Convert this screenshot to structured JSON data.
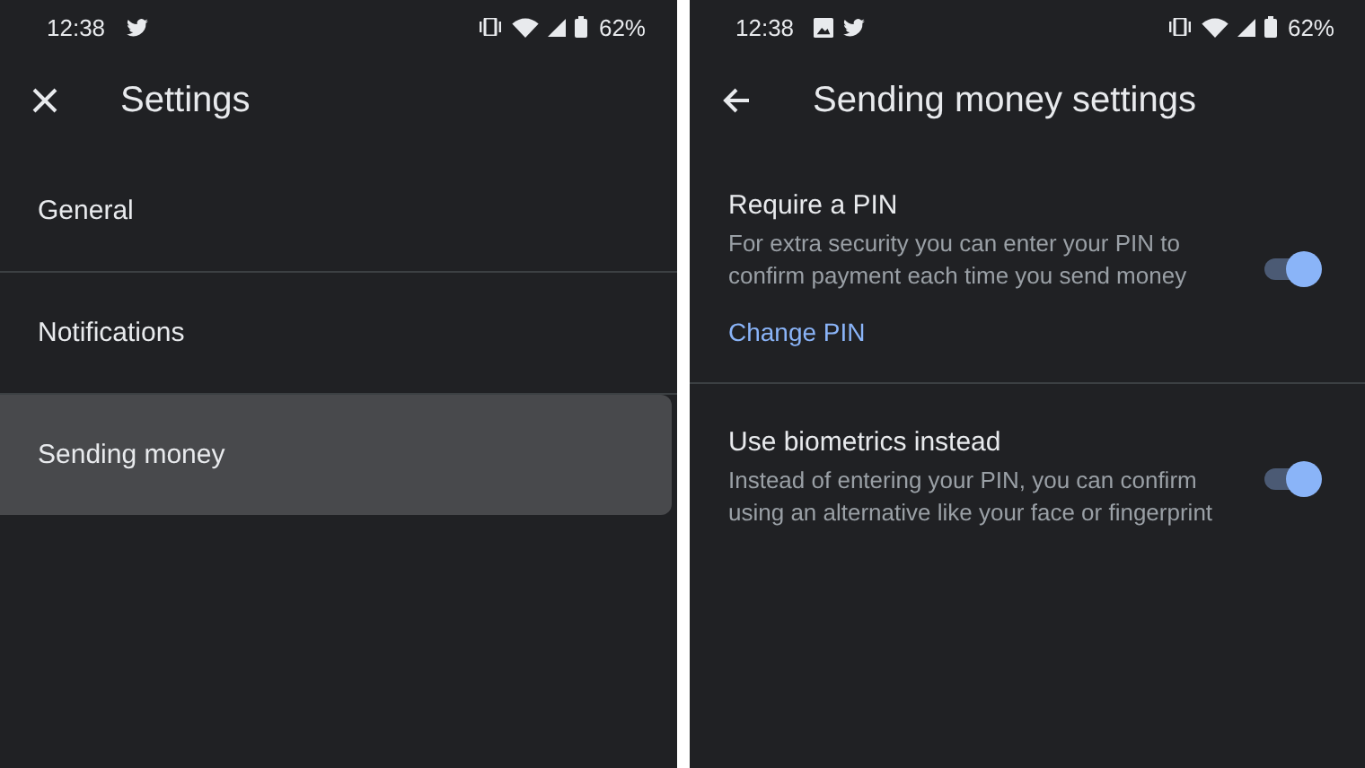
{
  "screens": [
    {
      "status_bar": {
        "time": "12:38",
        "notifications": [
          {
            "kind": "twitter"
          }
        ],
        "battery": "62%"
      },
      "header": {
        "nav": {
          "kind": "close"
        },
        "title": "Settings"
      },
      "items": [
        {
          "label": "General",
          "selected": false
        },
        {
          "label": "Notifications",
          "selected": false
        },
        {
          "label": "Sending money",
          "selected": true
        }
      ]
    },
    {
      "status_bar": {
        "time": "12:38",
        "notifications": [
          {
            "kind": "image"
          },
          {
            "kind": "twitter"
          }
        ],
        "battery": "62%"
      },
      "header": {
        "nav": {
          "kind": "back"
        },
        "title": "Sending money settings"
      },
      "settings": [
        {
          "title": "Require a PIN",
          "description": "For extra security you can enter your PIN to confirm payment each time you send money",
          "on": true,
          "link": "Change PIN"
        },
        {
          "title": "Use biometrics instead",
          "description": "Instead of entering your PIN, you can confirm using an alternative like your face or fingerprint",
          "on": true
        }
      ]
    }
  ]
}
